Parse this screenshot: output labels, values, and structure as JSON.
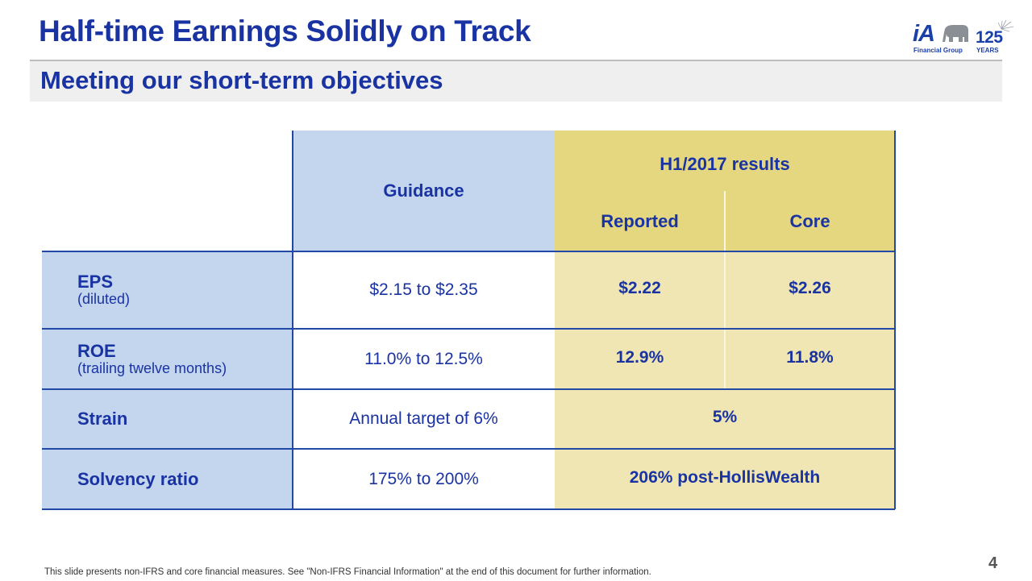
{
  "slide": {
    "title": "Half-time Earnings Solidly on Track",
    "subtitle": "Meeting our short-term objectives",
    "page_number": "4",
    "footnote": "This slide presents non-IFRS and core financial measures. See \"Non-IFRS Financial Information\" at the end of this document for further information."
  },
  "logo": {
    "brand": "iA",
    "icon": "elephant-icon",
    "tagline": "Financial Group",
    "anniversary": "125",
    "anniversary_label": "YEARS"
  },
  "table": {
    "headers": {
      "guidance": "Guidance",
      "results_group": "H1/2017 results",
      "reported": "Reported",
      "core": "Core"
    },
    "rows": [
      {
        "label": "EPS",
        "sublabel": "(diluted)",
        "guidance": "$2.15 to $2.35",
        "reported": "$2.22",
        "core": "$2.26"
      },
      {
        "label": "ROE",
        "sublabel": "(trailing twelve months)",
        "guidance": "11.0% to 12.5%",
        "reported": "12.9%",
        "core": "11.8%"
      },
      {
        "label": "Strain",
        "sublabel": "",
        "guidance": "Annual target of 6%",
        "result": "5%"
      },
      {
        "label": "Solvency ratio",
        "sublabel": "",
        "guidance": "175% to 200%",
        "result": "206% post-HollisWealth"
      }
    ]
  },
  "colors": {
    "primary_text": "#1a33a3",
    "guidance_header_bg": "#c3d6ee",
    "results_header_bg": "#e4d77f",
    "results_cell_bg": "#efe6b3",
    "grid_line": "#2349a6"
  }
}
